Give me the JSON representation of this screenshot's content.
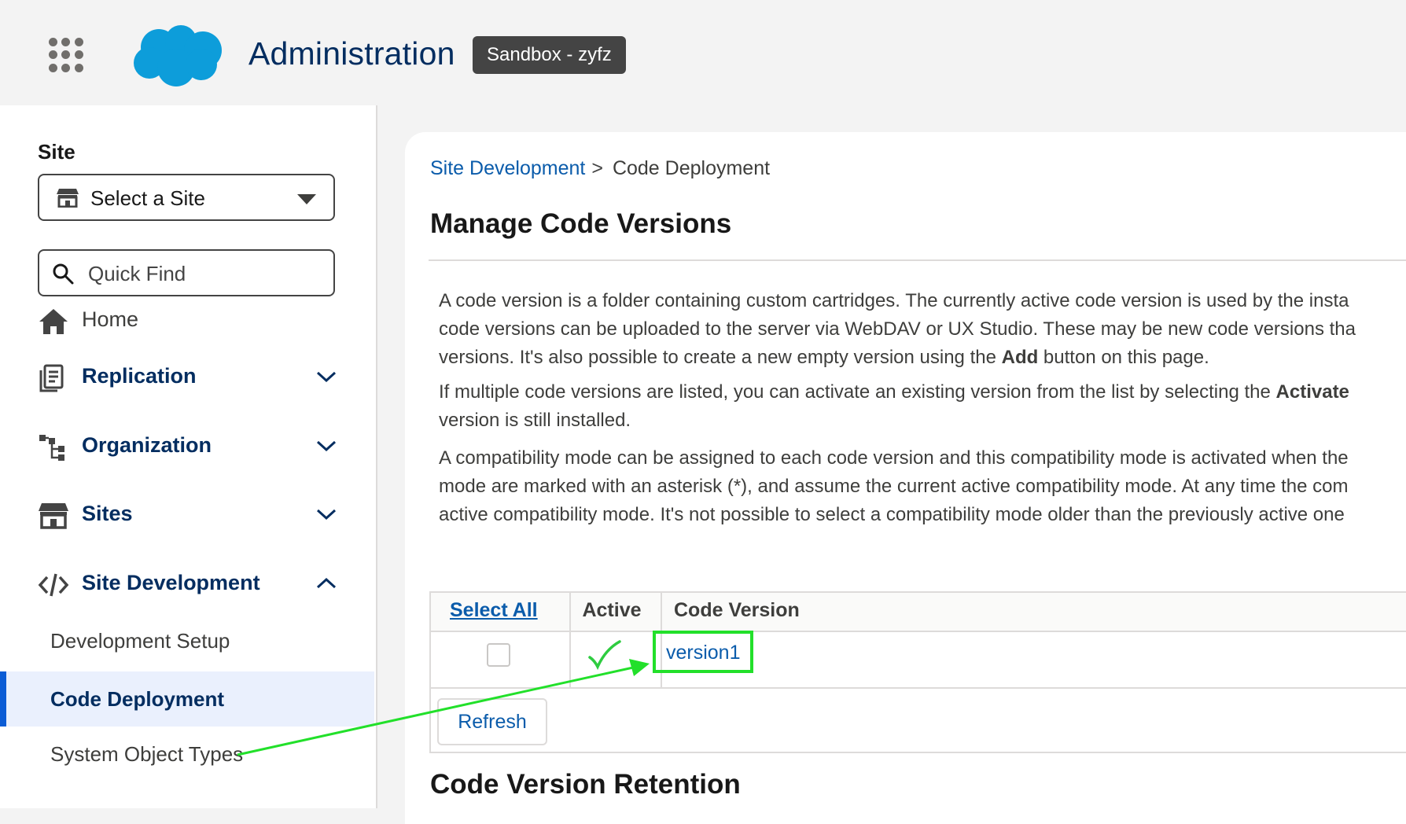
{
  "header": {
    "app_title": "Administration",
    "org_badge": "Sandbox - zyfz"
  },
  "sidebar": {
    "site_label": "Site",
    "site_select_value": "Select a Site",
    "quick_find_placeholder": "Quick Find",
    "nav": [
      {
        "label": "Home",
        "icon": "home-icon",
        "expanded": null
      },
      {
        "label": "Replication",
        "icon": "replication-icon",
        "expanded": false
      },
      {
        "label": "Organization",
        "icon": "hierarchy-icon",
        "expanded": false
      },
      {
        "label": "Sites",
        "icon": "store-icon",
        "expanded": false
      },
      {
        "label": "Site Development",
        "icon": "code-icon",
        "expanded": true
      }
    ],
    "sub_items": [
      {
        "label": "Development Setup",
        "active": false
      },
      {
        "label": "Code Deployment",
        "active": true
      },
      {
        "label": "System Object Types",
        "active": false
      }
    ]
  },
  "main": {
    "breadcrumb": {
      "parent": "Site Development",
      "separator": ">",
      "current": "Code Deployment"
    },
    "title": "Manage Code Versions",
    "paragraphs": [
      [
        "A code version is a folder containing custom cartridges. The currently active code version is used by the insta",
        "code versions can be uploaded to the server via WebDAV or UX Studio. These may be new code versions tha",
        {
          "before": "versions. It's also possible to create a new empty version using the ",
          "bold": "Add",
          "after": " button on this page."
        }
      ],
      [
        {
          "before": "If multiple code versions are listed, you can activate an existing version from the list by selecting the ",
          "bold": "Activate",
          "after": ""
        },
        "version is still installed."
      ],
      [
        "A compatibility mode can be assigned to each code version and this compatibility mode is activated when the",
        "mode are marked with an asterisk (*), and assume the current active compatibility mode. At any time the com",
        "active compatibility mode. It's not possible to select a compatibility mode older than the previously active one"
      ]
    ],
    "table": {
      "headers": [
        "Select All",
        "Active",
        "Code Version"
      ],
      "rows": [
        {
          "selected": false,
          "active": true,
          "version": "version1"
        }
      ],
      "refresh_label": "Refresh"
    },
    "next_section_title": "Code Version Retention"
  },
  "colors": {
    "brand_blue": "#0b5cd5",
    "nav_text": "#032d60",
    "link": "#0b5cab",
    "annotation_green": "#22e02a",
    "checkmark_green": "#2ecc40"
  }
}
